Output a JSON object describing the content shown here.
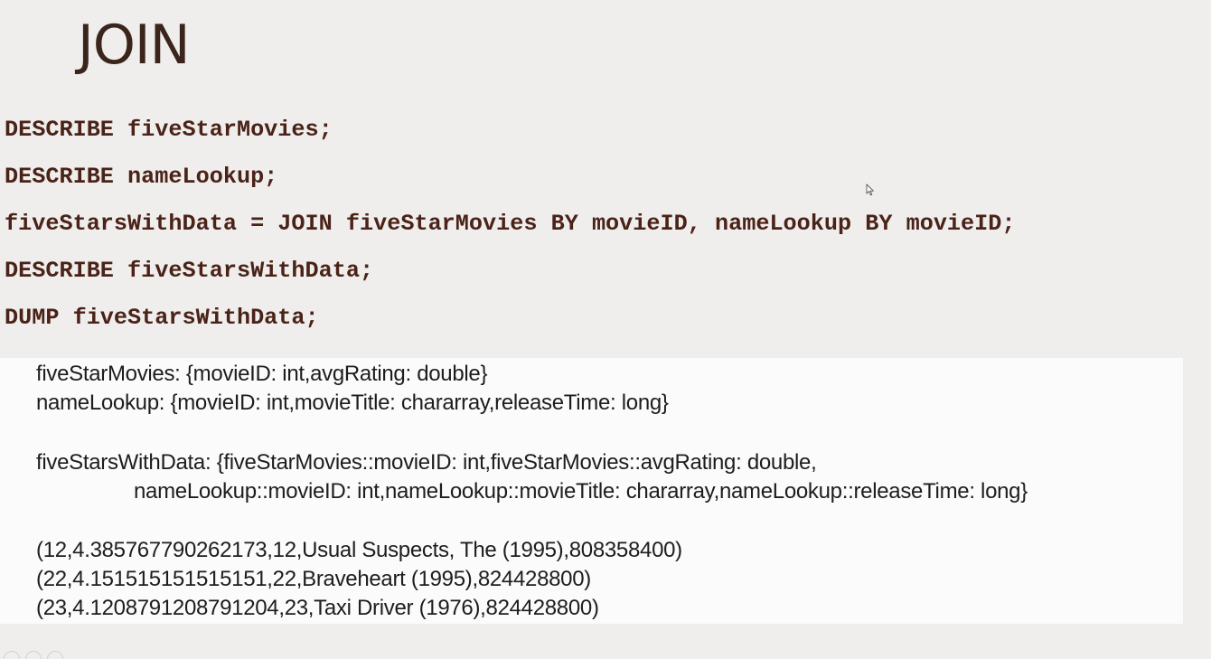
{
  "slide": {
    "title": "JOIN"
  },
  "code": {
    "lines": [
      "DESCRIBE fiveStarMovies;",
      "DESCRIBE nameLookup;",
      "fiveStarsWithData = JOIN fiveStarMovies BY movieID, nameLookup BY movieID;",
      "DESCRIBE fiveStarsWithData;",
      "DUMP fiveStarsWithData;"
    ]
  },
  "output": {
    "schema_line_1": "fiveStarMovies: {movieID: int,avgRating: double}",
    "schema_line_2": "nameLookup: {movieID: int,movieTitle: chararray,releaseTime: long}",
    "schema_line_3": "fiveStarsWithData: {fiveStarMovies::movieID: int,fiveStarMovies::avgRating: double,",
    "schema_line_4": "nameLookup::movieID: int,nameLookup::movieTitle: chararray,nameLookup::releaseTime: long}",
    "rows": [
      "(12,4.385767790262173,12,Usual Suspects, The (1995),808358400)",
      "(22,4.151515151515151,22,Braveheart (1995),824428800)",
      "(23,4.1208791208791204,23,Taxi Driver (1976),824428800)"
    ]
  },
  "colors": {
    "title": "#3a241c",
    "code": "#4a2218",
    "output_text": "#1d1d1d",
    "slide_background": "#efeeec",
    "output_background": "#fbfbfb"
  },
  "icons": {
    "cursor": "mouse-pointer-icon"
  }
}
